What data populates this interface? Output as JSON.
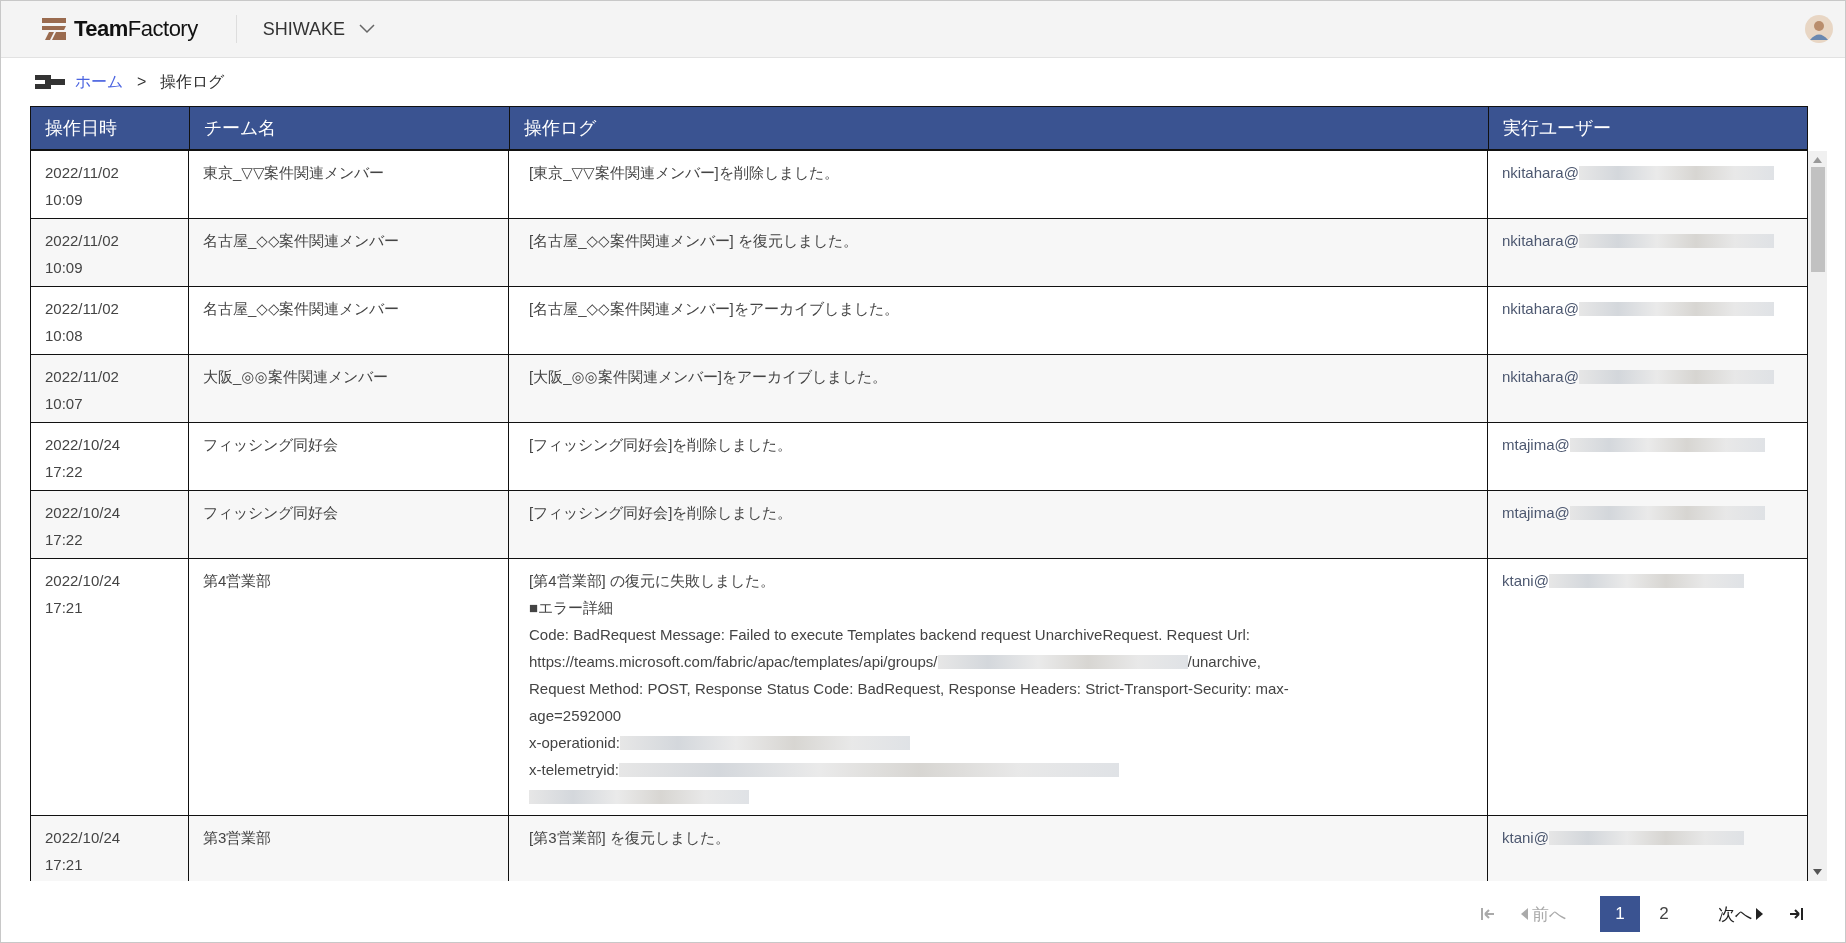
{
  "header": {
    "logo": "**Team**Factory",
    "workspace": "SHIWAKE"
  },
  "breadcrumb": {
    "home": "ホーム",
    "separator": ">",
    "current": "操作ログ"
  },
  "table": {
    "columns": [
      "操作日時",
      "チーム名",
      "操作ログ",
      "実行ユーザー"
    ],
    "rows": [
      {
        "date": "2022/11/02",
        "time": "10:09",
        "team": "東京_▽▽案件関連メンバー",
        "log": [
          {
            "parts": [
              {
                "kind": "text",
                "text": "[東京_▽▽案件関連メンバー]を削除しました。"
              }
            ]
          }
        ],
        "user": "nkitahara@"
      },
      {
        "date": "2022/11/02",
        "time": "10:09",
        "team": "名古屋_◇◇案件関連メンバー",
        "log": [
          {
            "parts": [
              {
                "kind": "text",
                "text": "[名古屋_◇◇案件関連メンバー] を復元しました。"
              }
            ]
          }
        ],
        "user": "nkitahara@"
      },
      {
        "date": "2022/11/02",
        "time": "10:08",
        "team": "名古屋_◇◇案件関連メンバー",
        "log": [
          {
            "parts": [
              {
                "kind": "text",
                "text": "[名古屋_◇◇案件関連メンバー]をアーカイブしました。"
              }
            ]
          }
        ],
        "user": "nkitahara@"
      },
      {
        "date": "2022/11/02",
        "time": "10:07",
        "team": "大阪_◎◎案件関連メンバー",
        "log": [
          {
            "parts": [
              {
                "kind": "text",
                "text": "[大阪_◎◎案件関連メンバー]をアーカイブしました。"
              }
            ]
          }
        ],
        "user": "nkitahara@"
      },
      {
        "date": "2022/10/24",
        "time": "17:22",
        "team": "フィッシング同好会",
        "log": [
          {
            "parts": [
              {
                "kind": "text",
                "text": "[フィッシング同好会]を削除しました。"
              }
            ]
          }
        ],
        "user": "mtajima@"
      },
      {
        "date": "2022/10/24",
        "time": "17:22",
        "team": "フィッシング同好会",
        "log": [
          {
            "parts": [
              {
                "kind": "text",
                "text": "[フィッシング同好会]を削除しました。"
              }
            ]
          }
        ],
        "user": "mtajima@"
      },
      {
        "date": "2022/10/24",
        "time": "17:21",
        "team": "第4営業部",
        "log": [
          {
            "parts": [
              {
                "kind": "text",
                "text": "[第4営業部] の復元に失敗しました。"
              }
            ]
          },
          {
            "parts": [
              {
                "kind": "text",
                "text": "■エラー詳細"
              }
            ]
          },
          {
            "parts": [
              {
                "kind": "text",
                "text": "Code: BadRequest Message: Failed to execute Templates backend request UnarchiveRequest. Request Url:"
              }
            ]
          },
          {
            "parts": [
              {
                "kind": "text",
                "text": "https://teams.microsoft.com/fabric/apac/templates/api/groups/"
              },
              {
                "kind": "blur"
              },
              {
                "kind": "text",
                "text": "/unarchive,"
              }
            ]
          },
          {
            "parts": [
              {
                "kind": "text",
                "text": "Request Method: POST, Response Status Code: BadRequest, Response Headers: Strict-Transport-Security: max-"
              }
            ]
          },
          {
            "parts": [
              {
                "kind": "text",
                "text": "age=2592000"
              }
            ]
          },
          {
            "parts": [
              {
                "kind": "text",
                "text": "x-operationid:"
              },
              {
                "kind": "blur"
              }
            ]
          },
          {
            "parts": [
              {
                "kind": "text",
                "text": "x-telemetryid:"
              },
              {
                "kind": "blur"
              }
            ]
          },
          {
            "parts": [
              {
                "kind": "blur"
              }
            ]
          }
        ],
        "user": "ktani@"
      },
      {
        "date": "2022/10/24",
        "time": "17:21",
        "team": "第3営業部",
        "log": [
          {
            "parts": [
              {
                "kind": "text",
                "text": "[第3営業部] を復元しました。"
              }
            ]
          }
        ],
        "user": "ktani@"
      }
    ]
  },
  "pagination": {
    "prev": {
      "label": "前へ",
      "disabled": true
    },
    "pages": [
      {
        "label": "1",
        "selected": true
      },
      {
        "label": "2",
        "selected": false
      }
    ],
    "next": {
      "label": "次へ",
      "disabled": false
    }
  }
}
